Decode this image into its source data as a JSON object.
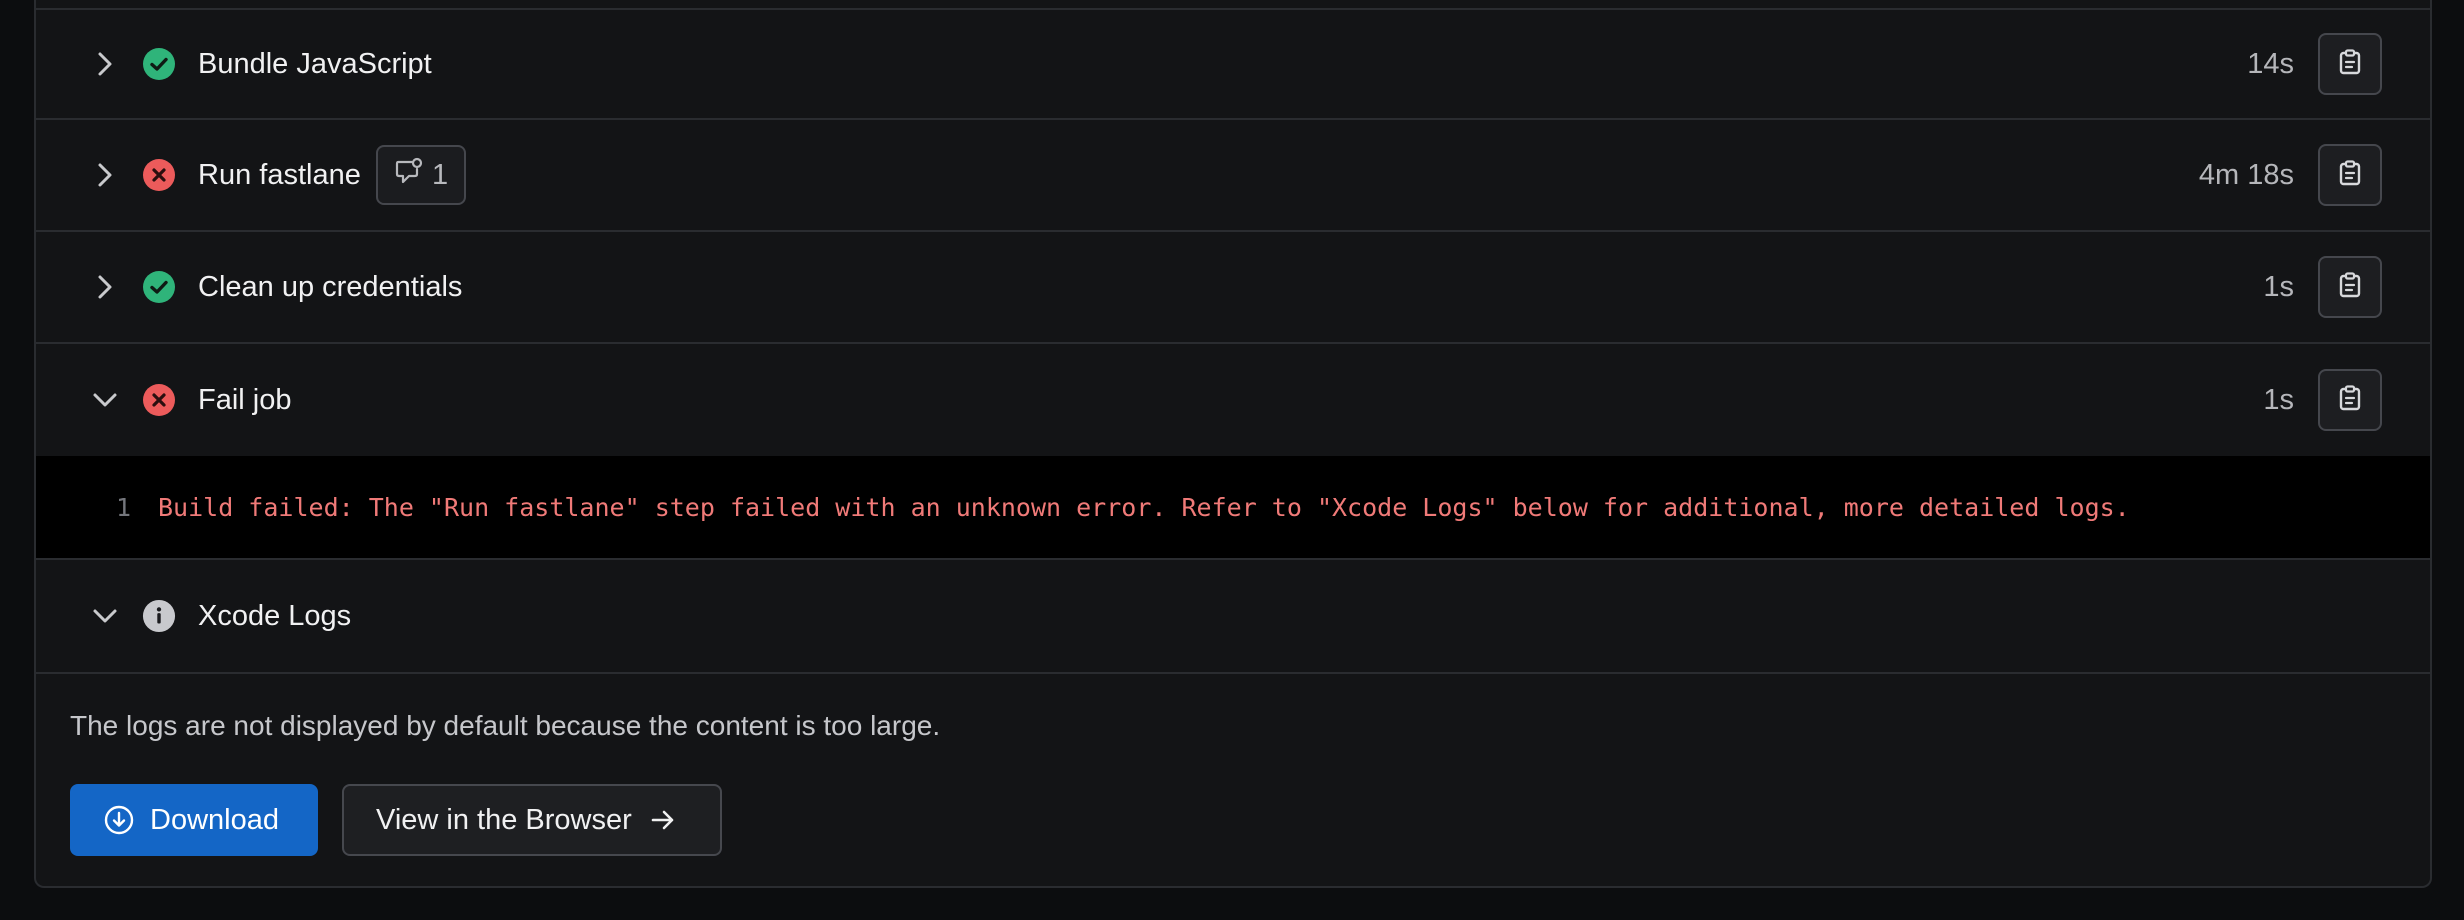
{
  "steps": [
    {
      "name": "Bundle JavaScript",
      "status": "success",
      "duration": "14s",
      "expanded": false
    },
    {
      "name": "Run fastlane",
      "status": "error",
      "duration": "4m 18s",
      "expanded": false,
      "annotation_count": "1"
    },
    {
      "name": "Clean up credentials",
      "status": "success",
      "duration": "1s",
      "expanded": false
    },
    {
      "name": "Fail job",
      "status": "error",
      "duration": "1s",
      "expanded": true
    },
    {
      "name": "Xcode Logs",
      "status": "info",
      "expanded": true
    }
  ],
  "fail_log": {
    "line_number": "1",
    "text": "Build failed: The \"Run fastlane\" step failed with an unknown error. Refer to \"Xcode Logs\" below for additional, more detailed logs."
  },
  "xcode_logs": {
    "note": "The logs are not displayed by default because the content is too large.",
    "download_label": "Download",
    "view_label": "View in the Browser"
  },
  "colors": {
    "success": "#2fb47a",
    "error": "#ec5b5b",
    "info": "#c8c9cd",
    "primary_button": "#1466c6",
    "log_text": "#f07a78"
  },
  "icons": {
    "collapsed": "chevron-right-icon",
    "expanded": "chevron-down-icon",
    "success": "check-circle-icon",
    "error": "x-circle-icon",
    "info": "info-icon",
    "copy": "clipboard-icon",
    "annotation": "comment-icon",
    "download": "download-circle-icon",
    "view": "arrow-right-icon"
  }
}
